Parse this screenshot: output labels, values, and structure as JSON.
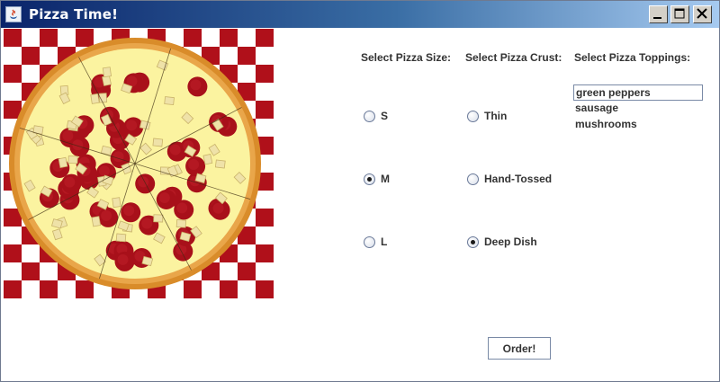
{
  "window": {
    "title": "Pizza Time!"
  },
  "headers": {
    "size": "Select Pizza Size:",
    "crust": "Select Pizza Crust:",
    "toppings": "Select Pizza Toppings:"
  },
  "sizes": [
    {
      "label": "S",
      "checked": false
    },
    {
      "label": "M",
      "checked": true
    },
    {
      "label": "L",
      "checked": false
    }
  ],
  "crusts": [
    {
      "label": "Thin",
      "checked": false
    },
    {
      "label": "Hand-Tossed",
      "checked": false
    },
    {
      "label": "Deep Dish",
      "checked": true
    }
  ],
  "toppings": [
    {
      "label": "green peppers",
      "selected": true
    },
    {
      "label": "sausage",
      "selected": false
    },
    {
      "label": "mushrooms",
      "selected": false
    }
  ],
  "order_button": "Order!",
  "colors": {
    "checker_red": "#b0101a",
    "checker_white": "#ffffff",
    "crust": "#d98c2a",
    "cheese": "#fbf3a0",
    "pepperoni": "#a8101a",
    "titlebar_start": "#0a246a",
    "titlebar_end": "#a6caf0"
  }
}
